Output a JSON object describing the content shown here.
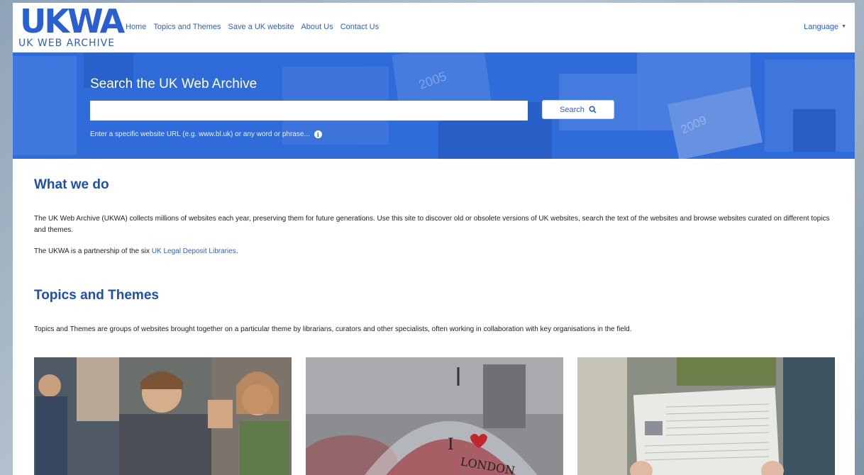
{
  "header": {
    "logo_mark": "UKWA",
    "logo_sub": "UK WEB ARCHIVE",
    "nav": [
      "Home",
      "Topics and Themes",
      "Save a UK website",
      "About Us",
      "Contact Us"
    ],
    "language_label": "Language"
  },
  "hero": {
    "title": "Search the UK Web Archive",
    "search_value": "",
    "search_button": "Search",
    "hint": "Enter a specific website URL (e.g. www.bl.uk) or any word or phrase...",
    "bg_years": [
      "2005",
      "2009"
    ]
  },
  "what_we_do": {
    "heading": "What we do",
    "para1": "The UK Web Archive (UKWA) collects millions of websites each year, preserving them for future generations. Use this site to discover old or obsolete versions of UK websites, search the text of the websites and browse websites curated on different topics and themes.",
    "para2_prefix": "The UKWA is a partnership of the six ",
    "para2_link": "UK Legal Deposit Libraries",
    "para2_suffix": "."
  },
  "topics": {
    "heading": "Topics and Themes",
    "para": "Topics and Themes are groups of websites brought together on a particular theme by librarians, curators and other specialists, often working in collaboration with key organisations in the field.",
    "cards": [
      {
        "name": "crowd-photo"
      },
      {
        "name": "umbrella-photo",
        "umbrella_text_1": "I",
        "umbrella_text_2": "LONDON"
      },
      {
        "name": "newspaper-photo"
      }
    ]
  },
  "colors": {
    "brand_blue": "#2a5fd1",
    "hero_blue": "#2f6bd9",
    "heading_blue": "#1e4fae"
  }
}
